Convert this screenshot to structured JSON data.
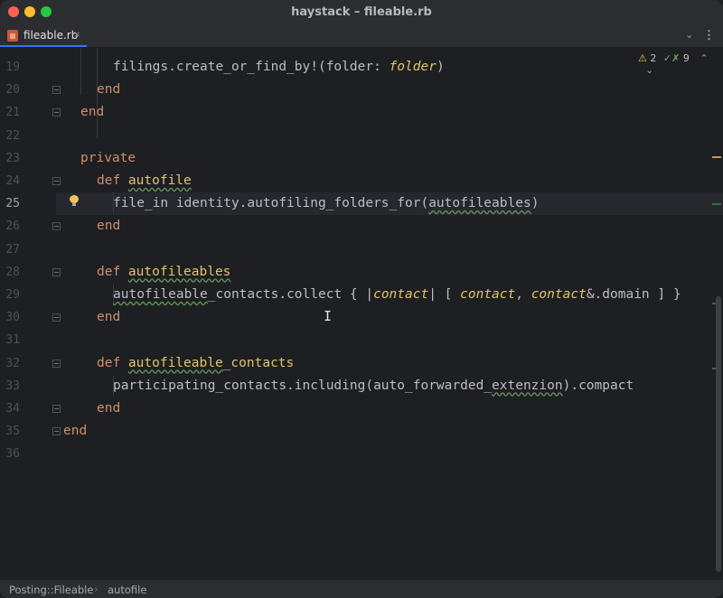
{
  "window": {
    "title": "haystack – fileable.rb"
  },
  "tabs": [
    {
      "label": "fileable.rb",
      "close": "×"
    }
  ],
  "tabbar": {
    "chevron": "⌄",
    "more": "⋮"
  },
  "inspections": {
    "warnings": "2",
    "passed": "9",
    "warn_glyph": "⚠",
    "check_glyph": "✓✗",
    "up": "⌃",
    "down": "⌄"
  },
  "code_lines": [
    {
      "n": "19",
      "parts": [
        [
          "sym",
          "filings.create_or_find_by!(folder: "
        ],
        [
          "it",
          "folder"
        ],
        [
          "sym",
          ")"
        ]
      ]
    },
    {
      "n": "20",
      "parts": [
        [
          "kw",
          "end"
        ]
      ]
    },
    {
      "n": "21",
      "parts": [
        [
          "kw",
          "end"
        ]
      ]
    },
    {
      "n": "22",
      "parts": []
    },
    {
      "n": "23",
      "parts": [
        [
          "kw",
          "private"
        ]
      ]
    },
    {
      "n": "24",
      "parts": [
        [
          "kw",
          "def "
        ],
        [
          "fnw",
          "autofile"
        ]
      ]
    },
    {
      "n": "25",
      "parts": [
        [
          "sym",
          "file_in identity.autofiling_folders_for("
        ],
        [
          "wv",
          "autofileables"
        ],
        [
          "sym",
          ")"
        ]
      ]
    },
    {
      "n": "26",
      "parts": [
        [
          "kw",
          "end"
        ]
      ]
    },
    {
      "n": "27",
      "parts": []
    },
    {
      "n": "28",
      "parts": [
        [
          "kw",
          "def "
        ],
        [
          "fnw",
          "autofileables"
        ]
      ]
    },
    {
      "n": "29",
      "parts": [
        [
          "wv",
          "autofileable"
        ],
        [
          "sym",
          "_contacts.collect { |"
        ],
        [
          "it",
          "contact"
        ],
        [
          "sym",
          "| [ "
        ],
        [
          "it",
          "contact"
        ],
        [
          "sym",
          ", "
        ],
        [
          "it",
          "contact"
        ],
        [
          "sym",
          "&.domain ] }"
        ]
      ]
    },
    {
      "n": "30",
      "parts": [
        [
          "kw",
          "end"
        ]
      ]
    },
    {
      "n": "31",
      "parts": []
    },
    {
      "n": "32",
      "parts": [
        [
          "kw",
          "def "
        ],
        [
          "fnw",
          "autofileable"
        ],
        [
          "fn",
          "_contacts"
        ]
      ]
    },
    {
      "n": "33",
      "parts": [
        [
          "sym",
          "participating_contacts.including(auto_forwarded_"
        ],
        [
          "wv",
          "extenzion"
        ],
        [
          "sym",
          ").compact"
        ]
      ]
    },
    {
      "n": "34",
      "parts": [
        [
          "kw",
          "end"
        ]
      ]
    },
    {
      "n": "35",
      "parts": [
        [
          "kw",
          "end"
        ]
      ]
    },
    {
      "n": "36",
      "parts": []
    }
  ],
  "current_line": "25",
  "breadcrumb": {
    "module": "Posting::Fileable",
    "separator": "›",
    "method": "autofile"
  },
  "colors": {
    "keyword": "#cf8e6d",
    "function": "#e0c46c",
    "text": "#bcbec4",
    "background": "#1e1f22"
  }
}
